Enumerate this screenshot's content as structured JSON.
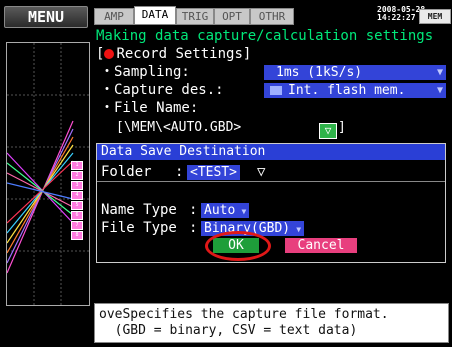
{
  "menu_label": "MENU",
  "tabs": [
    "AMP",
    "DATA",
    "TRIG",
    "OPT",
    "OTHR"
  ],
  "active_tab": "DATA",
  "clock": {
    "date": "2008-05-28",
    "time": "14:22:27"
  },
  "memusb": "MEM USB",
  "heading": "Making data capture/calculation settings",
  "section": "[●Record Settings]",
  "section_text": "Record Settings]",
  "section_open": "[",
  "settings": {
    "sampling": {
      "label": "・Sampling:",
      "value": "1ms (1kS/s)"
    },
    "capture": {
      "label": "・Capture des.:",
      "value": "Int. flash mem."
    },
    "file_name": {
      "label": "・File Name:",
      "value": "[\\MEM\\<AUTO.GBD>",
      "close": "]"
    }
  },
  "channel_markers": [
    "1",
    "2",
    "3",
    "4",
    "5",
    "6",
    "7",
    "8"
  ],
  "dialog": {
    "title": "Data Save Destination",
    "folder": {
      "label": "Folder",
      "sep": ":",
      "value": "<TEST>",
      "arrow": "▽"
    },
    "name_type": {
      "label": "Name Type",
      "sep": ":",
      "value": "Auto"
    },
    "file_type": {
      "label": "File Type",
      "sep": ":",
      "value": "Binary(GBD)"
    },
    "ok": "OK",
    "cancel": "Cancel"
  },
  "status": {
    "line1": "oveSpecifies the capture file format.",
    "line2": "  (GBD = binary, CSV = text data)"
  },
  "colors": {
    "accent_blue": "#3344d8",
    "ok_green": "#1e9e3a",
    "cancel_pink": "#e83f7e",
    "highlight_red": "#e01818",
    "heading_green": "#00e87a"
  }
}
